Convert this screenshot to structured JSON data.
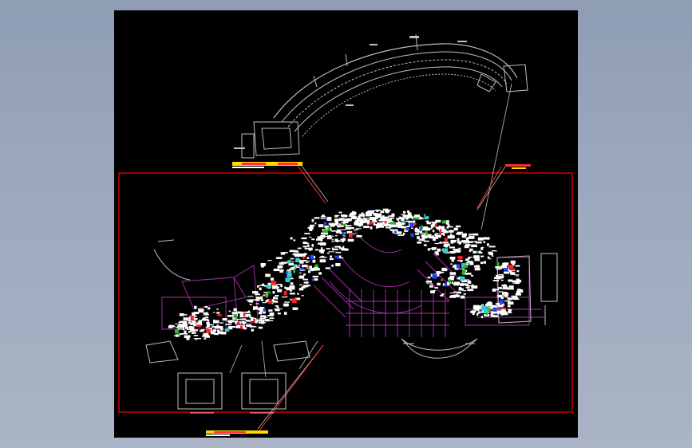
{
  "canvas": {
    "background": "#000000",
    "surround_color": "#9aa7bc"
  },
  "colors": {
    "frame": "#ff0000",
    "linework": "#bfbfbf",
    "structure": "#b030b0",
    "dense_text": "#ffffff",
    "accent_red": "#ff2020",
    "accent_green": "#20c020",
    "accent_blue": "#2040ff",
    "accent_cyan": "#30d0d0",
    "accent_yellow": "#ffd800"
  },
  "title_strips": [
    {
      "name": "title-strip-upper"
    },
    {
      "name": "title-strip-right"
    },
    {
      "name": "title-strip-lower"
    }
  ]
}
